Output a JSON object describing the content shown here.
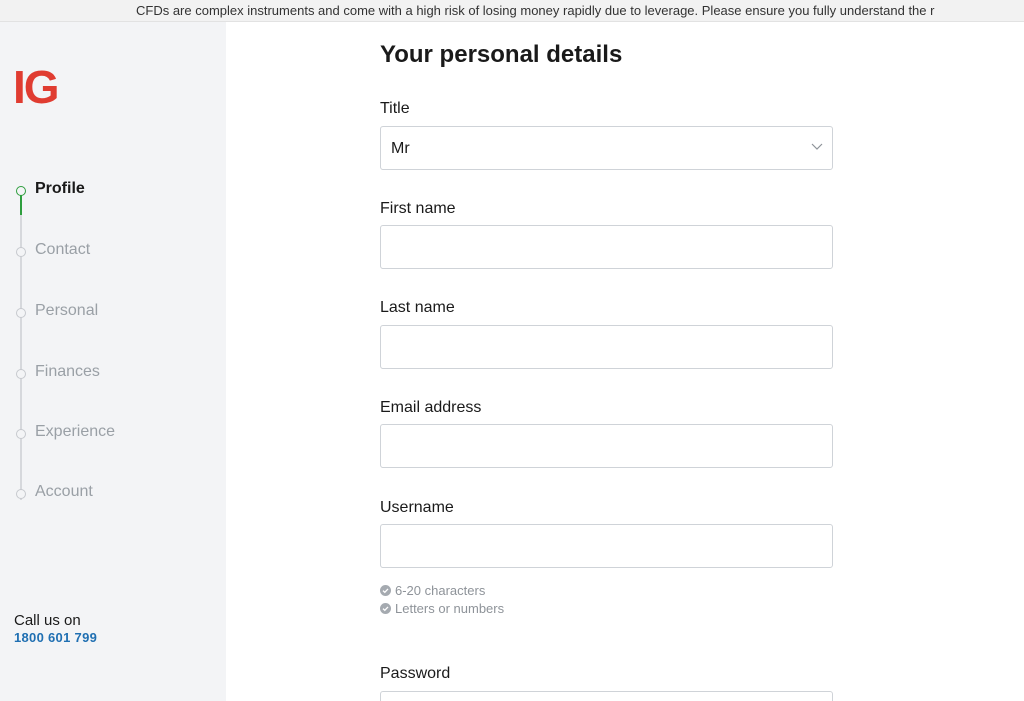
{
  "banner": {
    "text": "CFDs are complex instruments and come with a high risk of losing money rapidly due to leverage. Please ensure you fully understand the r"
  },
  "brand": {
    "logo_text": "IG",
    "logo_color": "#e03c31"
  },
  "steps": [
    {
      "label": "Profile",
      "active": true
    },
    {
      "label": "Contact",
      "active": false
    },
    {
      "label": "Personal",
      "active": false
    },
    {
      "label": "Finances",
      "active": false
    },
    {
      "label": "Experience",
      "active": false
    },
    {
      "label": "Account",
      "active": false
    }
  ],
  "contact": {
    "call_label": "Call us on",
    "phone": "1800 601 799"
  },
  "form": {
    "title": "Your personal details",
    "title_field": {
      "label": "Title",
      "value": "Mr"
    },
    "first_name": {
      "label": "First name",
      "value": ""
    },
    "last_name": {
      "label": "Last name",
      "value": ""
    },
    "email": {
      "label": "Email address",
      "value": ""
    },
    "username": {
      "label": "Username",
      "value": "",
      "hints": [
        "6-20 characters",
        "Letters or numbers"
      ]
    },
    "password": {
      "label": "Password",
      "value": ""
    }
  },
  "colors": {
    "accent_green": "#2e9e3e",
    "link_blue": "#1f6fb2",
    "sidebar_bg": "#f3f4f6"
  }
}
